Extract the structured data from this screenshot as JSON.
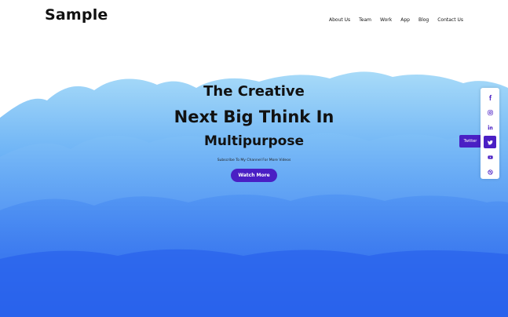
{
  "brand": {
    "logo_text": "Sample"
  },
  "nav": {
    "items": [
      {
        "label": "About Us"
      },
      {
        "label": "Team"
      },
      {
        "label": "Work"
      },
      {
        "label": "App"
      },
      {
        "label": "Blog"
      },
      {
        "label": "Contact Us"
      }
    ]
  },
  "hero": {
    "line1": "The Creative",
    "line2": "Next Big Think In",
    "line3": "Multipurpose",
    "subtitle": "Subscribe To My Channel For More Videos",
    "cta_label": "Watch More"
  },
  "social": {
    "items": [
      {
        "icon": "facebook-icon"
      },
      {
        "icon": "instagram-icon"
      },
      {
        "icon": "linkedin-icon"
      },
      {
        "icon": "twitter-icon"
      },
      {
        "icon": "youtube-icon"
      },
      {
        "icon": "dribbble-icon"
      }
    ],
    "tooltip": "Twitter"
  },
  "colors": {
    "accent": "#4a1fc4",
    "watercolor_light": "#9fd3f7",
    "watercolor_dark": "#2f6ef2",
    "background": "#ffffff"
  }
}
